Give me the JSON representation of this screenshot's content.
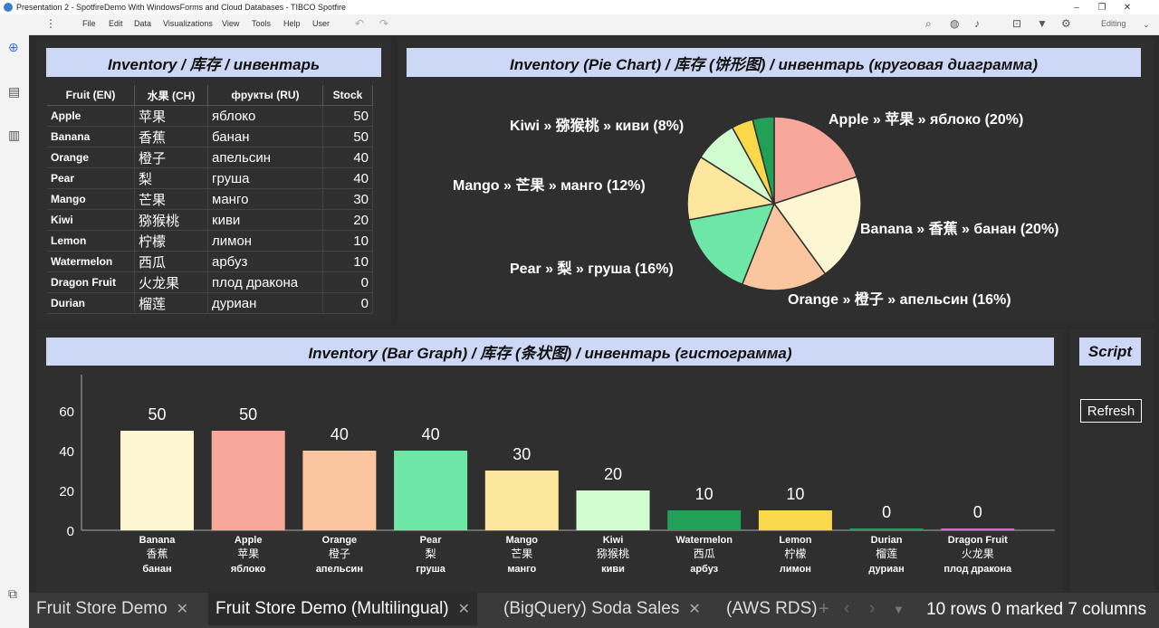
{
  "window": {
    "title": "Presentation 2 - SpotfireDemo With WindowsForms and Cloud Databases - TIBCO Spotfire"
  },
  "menu": {
    "items": [
      "File",
      "Edit",
      "Data",
      "Visualizations",
      "View",
      "Tools",
      "Help",
      "User"
    ],
    "mode": "Editing"
  },
  "inventory_table": {
    "title": "Inventory / 库存 / инвентарь",
    "columns": [
      "Fruit (EN)",
      "水果 (CH)",
      "фрукты (RU)",
      "Stock"
    ],
    "rows": [
      [
        "Apple",
        "苹果",
        "яблоко",
        "50"
      ],
      [
        "Banana",
        "香蕉",
        "банан",
        "50"
      ],
      [
        "Orange",
        "橙子",
        "апельсин",
        "40"
      ],
      [
        "Pear",
        "梨",
        "груша",
        "40"
      ],
      [
        "Mango",
        "芒果",
        "манго",
        "30"
      ],
      [
        "Kiwi",
        "猕猴桃",
        "киви",
        "20"
      ],
      [
        "Lemon",
        "柠檬",
        "лимон",
        "10"
      ],
      [
        "Watermelon",
        "西瓜",
        "арбуз",
        "10"
      ],
      [
        "Dragon Fruit",
        "火龙果",
        "плод дракона",
        "0"
      ],
      [
        "Durian",
        "榴莲",
        "дуриан",
        "0"
      ]
    ]
  },
  "pie": {
    "title": "Inventory (Pie Chart) / 库存 (饼形图) / инвентарь (круговая диаграмма)",
    "slices": [
      {
        "label": "Apple » 苹果 » яблоко (20%)",
        "value": 20,
        "color": "#f8a79b"
      },
      {
        "label": "Banana » 香蕉 » банан (20%)",
        "value": 20,
        "color": "#fdf6d2"
      },
      {
        "label": "Orange » 橙子 » апельсин (16%)",
        "value": 16,
        "color": "#fbc59f"
      },
      {
        "label": "Pear » 梨 » груша (16%)",
        "value": 16,
        "color": "#6ee6a5"
      },
      {
        "label": "Mango » 芒果 » манго (12%)",
        "value": 12,
        "color": "#fde79f"
      },
      {
        "label": "Kiwi » 猕猴桃 » киви (8%)",
        "value": 8,
        "color": "#d0fcd0"
      },
      {
        "label": "",
        "value": 4,
        "color": "#f9d84a"
      },
      {
        "label": "",
        "value": 4,
        "color": "#22a058"
      }
    ]
  },
  "bar": {
    "title": "Inventory (Bar Graph) / 库存 (条状图) / инвентарь (гистограмма)"
  },
  "script_panel": {
    "title": "Script",
    "refresh_label": "Refresh"
  },
  "tabs": [
    {
      "label": "Fruit Store Demo",
      "active": false
    },
    {
      "label": "Fruit Store Demo (Multilingual)",
      "active": true
    },
    {
      "label": "(BigQuery) Soda Sales",
      "active": false
    },
    {
      "label": "(AWS RDS)",
      "active": false
    }
  ],
  "status": "10 rows 0 marked 7 columns",
  "chart_data": {
    "type": "bar",
    "categories": [
      [
        "Banana",
        "香蕉",
        "банан"
      ],
      [
        "Apple",
        "苹果",
        "яблоко"
      ],
      [
        "Orange",
        "橙子",
        "апельсин"
      ],
      [
        "Pear",
        "梨",
        "груша"
      ],
      [
        "Mango",
        "芒果",
        "манго"
      ],
      [
        "Kiwi",
        "猕猴桃",
        "киви"
      ],
      [
        "Watermelon",
        "西瓜",
        "арбуз"
      ],
      [
        "Lemon",
        "柠檬",
        "лимон"
      ],
      [
        "Durian",
        "榴莲",
        "дуриан"
      ],
      [
        "Dragon Fruit",
        "火龙果",
        "плод дракона"
      ]
    ],
    "values": [
      50,
      50,
      40,
      40,
      30,
      20,
      10,
      10,
      0,
      0
    ],
    "colors": [
      "#fdf6d2",
      "#f8a79b",
      "#fbc59f",
      "#6ee6a5",
      "#fde79f",
      "#d0fcd0",
      "#22a058",
      "#f9d84a",
      "#22a058",
      "#d06fc8"
    ],
    "yticks": [
      0,
      20,
      40,
      60
    ],
    "ylim": [
      0,
      70
    ]
  }
}
